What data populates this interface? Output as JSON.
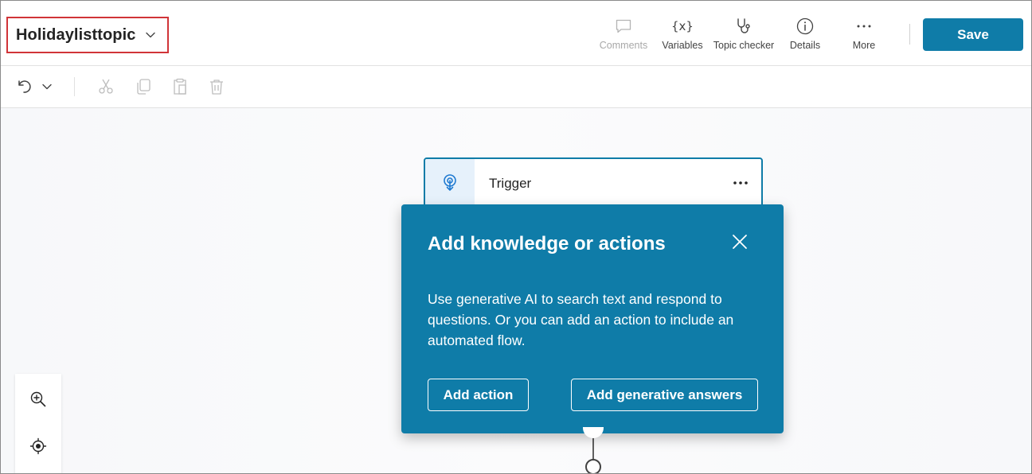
{
  "header": {
    "topic_title": "Holidaylisttopic",
    "commands": {
      "comments": "Comments",
      "variables": "Variables",
      "topic_checker": "Topic checker",
      "details": "Details",
      "more": "More"
    },
    "variables_glyph": "{x}",
    "save_label": "Save"
  },
  "toolbar": {
    "icons": [
      "undo-icon",
      "chevron-down-icon",
      "cut-icon",
      "copy-icon",
      "paste-icon",
      "delete-icon"
    ]
  },
  "canvas": {
    "trigger_node": {
      "label": "Trigger",
      "icon": "trigger-icon"
    },
    "popover": {
      "title": "Add knowledge or actions",
      "body": "Use generative AI to search text and respond to questions. Or you can add an action to include an automated flow.",
      "add_action_label": "Add action",
      "add_generative_label": "Add generative answers"
    },
    "zoom_controls": [
      "zoom-in-icon",
      "recenter-icon"
    ]
  },
  "colors": {
    "accent": "#0f7ca8",
    "highlight_border": "#d13438",
    "trigger_icon_bg": "#e6f1fb"
  }
}
